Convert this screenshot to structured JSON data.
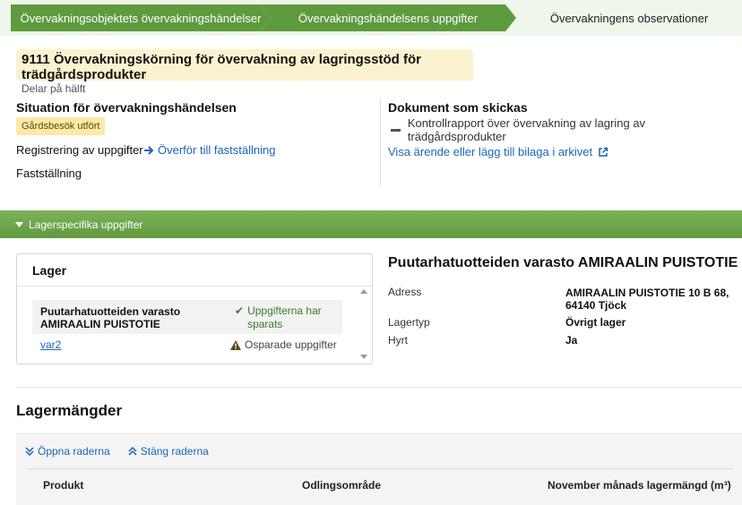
{
  "steps": [
    {
      "label": "Övervakningsobjektets övervakningshändelser",
      "state": "done"
    },
    {
      "label": "Övervakningshändelsens uppgifter",
      "state": "done"
    },
    {
      "label": "Övervakningens observationer",
      "state": "current"
    }
  ],
  "colors": {
    "step_green": "#5e9a3e",
    "link": "#1c64b9",
    "badge": "#fbe9a8",
    "section_bar": "#6aa647"
  },
  "object": {
    "title": "9111 Övervakningskörning för övervakning av lagringsstöd för trädgårdsprodukter",
    "subtitle": "Delar på hälft"
  },
  "situation": {
    "heading": "Situation för övervakningshändelsen",
    "badge": "Gårdsbesök utfört",
    "registration_label": "Registrering av uppgifter",
    "transfer_link": "Överför till fastställning",
    "confirmation_label": "Fastställning"
  },
  "documents": {
    "heading": "Dokument som skickas",
    "items": [
      "Kontrollrapport över övervakning av lagring av trädgårdsprodukter"
    ],
    "archive_link": "Visa ärende eller lägg till bilaga i arkivet"
  },
  "section": {
    "label": "Lagerspecifika uppgifter"
  },
  "storage": {
    "heading": "Lager",
    "rows": [
      {
        "name": "Puutarhatuotteiden varasto AMIRAALIN PUISTOTIE",
        "status": "Uppgifterna har sparats",
        "status_icon": "check-icon"
      },
      {
        "name": "var2",
        "status": "Osparade uppgifter",
        "status_icon": "warning-icon"
      }
    ]
  },
  "details": {
    "title": "Puutarhatuotteiden varasto AMIRAALIN PUISTOTIE",
    "address_label": "Adress",
    "address_line1": "AMIRAALIN PUISTOTIE 10 B 68,",
    "address_line2": "64140 Tjöck",
    "type_label": "Lagertyp",
    "type_value": "Övrigt lager",
    "rented_label": "Hyrt",
    "rented_value": "Ja"
  },
  "stock": {
    "heading": "Lagermängder",
    "open_rows": "Öppna raderna",
    "close_rows": "Stäng raderna",
    "columns": [
      "Produkt",
      "Odlingsområde",
      "November månads lagermängd (m³)"
    ]
  }
}
